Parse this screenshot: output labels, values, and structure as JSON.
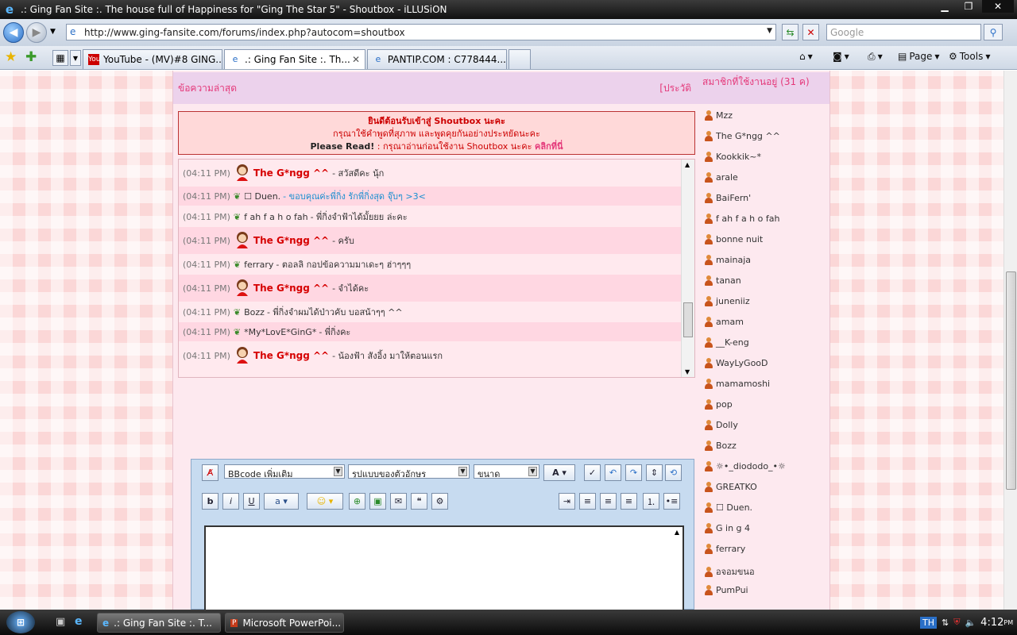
{
  "window": {
    "title": ".: Ging Fan Site :. The house full of Happiness for \"Ging The Star 5\" - Shoutbox - iLLUSiON"
  },
  "addressbar": {
    "url": "http://www.ging-fansite.com/forums/index.php?autocom=shoutbox",
    "search_placeholder": "Google"
  },
  "tabs": [
    {
      "label": "YouTube - (MV)#8 GING..."
    },
    {
      "label": ".: Ging Fan Site :. Th..."
    },
    {
      "label": "PANTIP.COM : C778444..."
    }
  ],
  "commandbar": {
    "page_label": "Page",
    "tools_label": "Tools"
  },
  "shoutbox": {
    "header_left": "ข้อความล่าสุด",
    "header_right": "[ประวัติ",
    "welcome": {
      "line1": "ยินดีต้อนรับเข้าสู่ Shoutbox นะคะ",
      "line2": "กรุณาใช้คำพูดที่สุภาพ และพูดคุยกันอย่างประหยัดนะคะ",
      "line3_bold": "Please Read!",
      "line3_text": ": กรุณาอ่านก่อนใช้งาน Shoutbox นะคะ",
      "line3_link": "คลิกที่นี่"
    },
    "messages": [
      {
        "time": "(04:11 PM)",
        "name": "The G*ngg ^^",
        "text": "- สวัสดีคะ นุ้ก"
      },
      {
        "time": "(04:11 PM)",
        "name": "☐ Duen.",
        "text": "- ขอบคุณค่ะพี่กิ่ง รักพี่กิ่งสุด จุ๊บๆ >3<"
      },
      {
        "time": "(04:11 PM)",
        "name": "f ah f a h o fah",
        "text": "- พี่กิ่งจำฟ้าได้มั้ยยย ล่ะคะ"
      },
      {
        "time": "(04:11 PM)",
        "name": "The G*ngg ^^",
        "text": "- ครับ"
      },
      {
        "time": "(04:11 PM)",
        "name": "ferrary",
        "text": "- ตอลลิ กอปข้อความมาเดะๆ ฮ่าๆๆๆ"
      },
      {
        "time": "(04:11 PM)",
        "name": "The G*ngg ^^",
        "text": "- จำได้คะ"
      },
      {
        "time": "(04:11 PM)",
        "name": "Bozz",
        "text": "- พี่กิ่งจำผมได้ป่าวคับ บอสน้าๆๆ ^^"
      },
      {
        "time": "(04:11 PM)",
        "name": "*My*LovE*GinG*",
        "text": "- พี่กิ่งคะ"
      },
      {
        "time": "(04:11 PM)",
        "name": "The G*ngg ^^",
        "text": "- น้องฟ้า สังอิ้ง มาให้ตอนแรก"
      }
    ]
  },
  "editor": {
    "bbcode": "BBcode เพิ่มเติม",
    "fontstyle": "รูปแบบของตัวอักษร",
    "size": "ขนาด",
    "bold": "b",
    "italic": "i",
    "underline": "u"
  },
  "online": {
    "header": "สมาชิกที่ใช้งานอยู่ (31 ค)",
    "users": [
      "Mzz",
      "The G*ngg ^^",
      "Kookkik~*",
      "arale",
      "BaiFern'",
      "f ah f a h o fah",
      "bonne nuit",
      "mainaja",
      "tanan",
      "juneniiz",
      "amam",
      "__K-eng",
      "WayLyGooD",
      "mamamoshi",
      "pop",
      "Dolly",
      "Bozz",
      "☼•_diododo_•☼",
      "GREATKO",
      "☐ Duen.",
      "G in g 4",
      "ferrary",
      "อจอมขนอ",
      "PumPui"
    ]
  },
  "taskbar": {
    "items": [
      ".: Ging Fan Site :. T...",
      "Microsoft PowerPoi..."
    ],
    "lang": "TH",
    "clock": "4:12",
    "clock_suffix": "PM"
  }
}
